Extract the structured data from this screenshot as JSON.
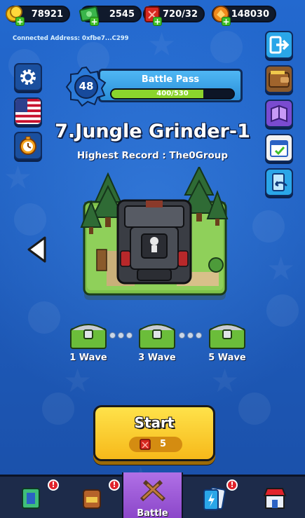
{
  "resources": {
    "coins": "78921",
    "cash": "2545",
    "energy": "720/32",
    "tokens": "148030"
  },
  "wallet": {
    "connected_text": "Connected Address: 0xfbe7...C299"
  },
  "battle_pass": {
    "level": "48",
    "title": "Battle Pass",
    "progress_text": "400/530",
    "progress_fraction": 0.7547
  },
  "stage": {
    "title": "7.Jungle Grinder-1",
    "record": "Highest Record : The0Group"
  },
  "rewards": [
    {
      "label": "1 Wave"
    },
    {
      "label": "3 Wave"
    },
    {
      "label": "5 Wave"
    }
  ],
  "start_button": {
    "label": "Start",
    "cost": "5"
  },
  "bottom_nav": {
    "battle_label": "Battle",
    "alert_mark": "!"
  },
  "icons": {
    "left_side": [
      "gear-icon",
      "us-flag-icon",
      "stopwatch-icon"
    ],
    "right_side": [
      "exit-icon",
      "wallet-icon",
      "book-icon",
      "calendar-icon",
      "share-icon"
    ]
  },
  "colors": {
    "background": "#1f63c4",
    "start": "#ffd230",
    "progress": "#8bd42c",
    "battle_tab": "#a060dc"
  }
}
